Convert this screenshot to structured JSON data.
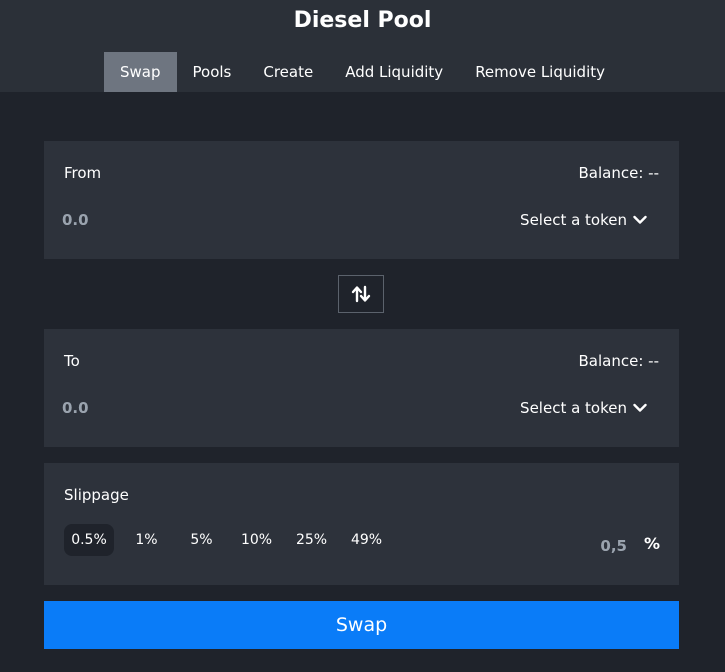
{
  "app": {
    "title": "Diesel Pool"
  },
  "nav": {
    "tabs": [
      {
        "label": "Swap",
        "active": true
      },
      {
        "label": "Pools"
      },
      {
        "label": "Create"
      },
      {
        "label": "Add Liquidity"
      },
      {
        "label": "Remove Liquidity"
      }
    ]
  },
  "from": {
    "label": "From",
    "balance": "Balance: --",
    "amount_placeholder": "0.0",
    "token_select_label": "Select a token",
    "token_select_icon": "chevron-down-icon"
  },
  "switch": {
    "icon": "swap-arrows-icon"
  },
  "to": {
    "label": "To",
    "balance": "Balance: --",
    "amount_placeholder": "0.0",
    "token_select_label": "Select a token",
    "token_select_icon": "chevron-down-icon"
  },
  "slippage": {
    "label": "Slippage",
    "options": [
      "0.5%",
      "1%",
      "5%",
      "10%",
      "25%",
      "49%"
    ],
    "selected": "0.5%",
    "custom_placeholder": "0,5",
    "unit": "%"
  },
  "action": {
    "swap_label": "Swap"
  },
  "colors": {
    "background": "#1f232b",
    "header": "#2b3038",
    "card": "#2d323b",
    "tab_active": "#6e7580",
    "accent": "#0a7cf8",
    "muted_text": "#9aa3ae"
  }
}
